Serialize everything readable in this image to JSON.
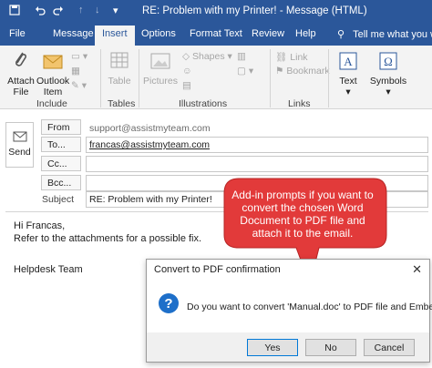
{
  "window": {
    "title": "RE: Problem with my Printer!  -  Message (HTML)"
  },
  "tabs": [
    {
      "label": "File"
    },
    {
      "label": "Message"
    },
    {
      "label": "Insert"
    },
    {
      "label": "Options"
    },
    {
      "label": "Format Text"
    },
    {
      "label": "Review"
    },
    {
      "label": "Help"
    }
  ],
  "tellme": {
    "label": "Tell me what you want"
  },
  "ribbon": {
    "attach_file": {
      "line1": "Attach",
      "line2": "File"
    },
    "outlook_item": {
      "line1": "Outlook",
      "line2": "Item"
    },
    "table": {
      "label": "Table"
    },
    "pictures": {
      "label": "Pictures"
    },
    "shapes": {
      "label": "Shapes"
    },
    "link": {
      "label": "Link"
    },
    "bookmark": {
      "label": "Bookmark"
    },
    "text": {
      "label": "Text"
    },
    "symbols": {
      "label": "Symbols"
    },
    "groups": {
      "include": "Include",
      "tables": "Tables",
      "illustrations": "Illustrations",
      "links": "Links"
    }
  },
  "compose": {
    "send_label": "Send",
    "from_label": "From",
    "from_value": "support@assistmyteam.com",
    "to_label": "To...",
    "to_value": "francas@assistmyteam.com",
    "cc_label": "Cc...",
    "bcc_label": "Bcc...",
    "subject_label": "Subject",
    "subject_value": "RE: Problem with my Printer!"
  },
  "body": {
    "line1": "Hi Francas,",
    "line2": "Refer to the attachments for a possible fix.",
    "line3": "Helpdesk Team"
  },
  "callout": {
    "line1": "Add-in prompts if you want to",
    "line2": "convert the chosen Word",
    "line3": "Document to PDF file and",
    "line4": "attach it to the email.",
    "fill_color": "#e23a3a"
  },
  "dialog": {
    "title": "Convert to PDF confirmation",
    "message": "Do you want to convert 'Manual.doc' to PDF file and Embed?",
    "yes_label": "Yes",
    "no_label": "No",
    "cancel_label": "Cancel"
  },
  "colors": {
    "titlebar": "#2b579a",
    "accent": "#0078d7"
  }
}
